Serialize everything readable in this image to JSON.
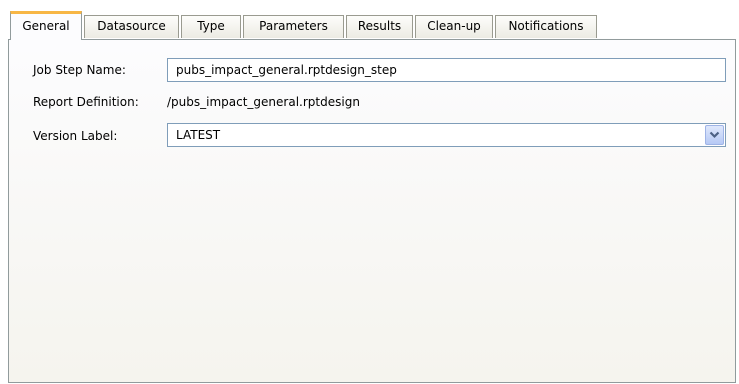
{
  "tabs": [
    {
      "label": "General",
      "active": true
    },
    {
      "label": "Datasource",
      "active": false
    },
    {
      "label": "Type",
      "active": false
    },
    {
      "label": "Parameters",
      "active": false
    },
    {
      "label": "Results",
      "active": false
    },
    {
      "label": "Clean-up",
      "active": false
    },
    {
      "label": "Notifications",
      "active": false
    }
  ],
  "form": {
    "job_step_name_label": "Job Step Name:",
    "job_step_name_value": "pubs_impact_general.rptdesign_step",
    "report_definition_label": "Report Definition:",
    "report_definition_value": "/pubs_impact_general.rptdesign",
    "version_label_label": "Version Label:",
    "version_label_value": "LATEST"
  },
  "icons": {
    "dropdown": "chevron-down-icon"
  },
  "colors": {
    "active_tab_accent": "#f7b645",
    "panel_border": "#919b9c",
    "input_border": "#7f9db9"
  }
}
